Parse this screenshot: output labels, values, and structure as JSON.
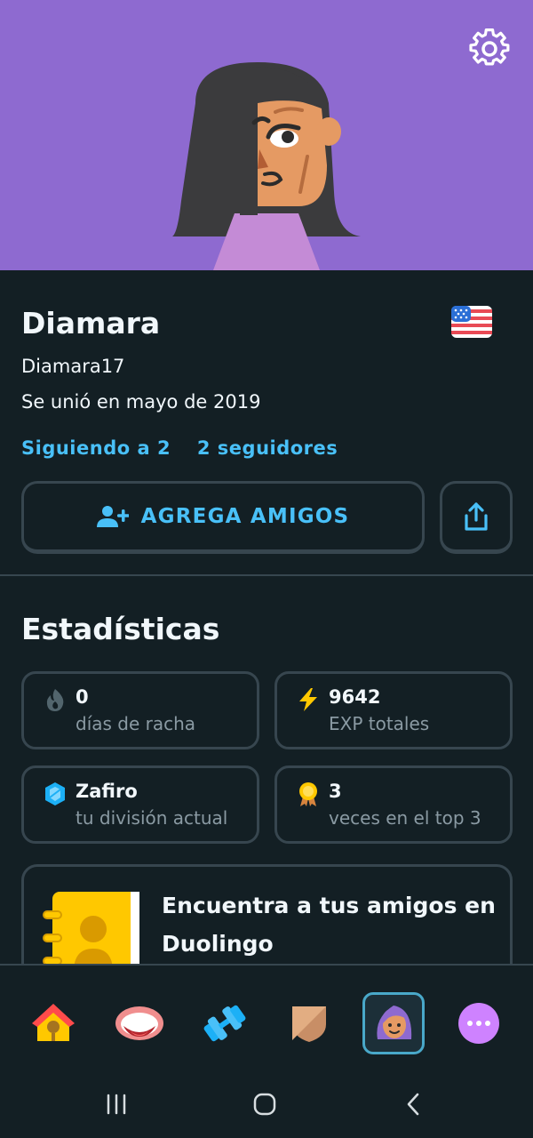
{
  "header": {
    "settings_icon": "gear-icon",
    "avatar": "avatar-illustration",
    "background_color": "#8e6ad0"
  },
  "profile": {
    "name": "Diamara",
    "username": "Diamara17",
    "joined": "Se unió en mayo de 2019",
    "following": "Siguiendo a 2",
    "followers": "2 seguidores",
    "flag_icon": "us-flag-icon",
    "add_friends_label": "AGREGA AMIGOS",
    "share_icon": "share-icon"
  },
  "stats": {
    "title": "Estadísticas",
    "items": [
      {
        "value": "0",
        "label": "días de racha",
        "icon": "flame-icon"
      },
      {
        "value": "9642",
        "label": "EXP totales",
        "icon": "lightning-icon"
      },
      {
        "value": "Zafiro",
        "label": "tu división actual",
        "icon": "sapphire-icon"
      },
      {
        "value": "3",
        "label": "veces en el top 3",
        "icon": "medal-icon"
      }
    ]
  },
  "find_friends": {
    "text": "Encuentra a tus amigos en Duolingo",
    "icon": "contacts-book-icon"
  },
  "bottom_nav": {
    "tabs": [
      "home-icon",
      "speaking-icon",
      "practice-icon",
      "leagues-icon",
      "profile-icon",
      "more-icon"
    ],
    "active": "profile"
  },
  "colors": {
    "accent": "#49c0f8",
    "background": "#131f24",
    "border": "#37464f",
    "muted": "#8a9aa3"
  }
}
